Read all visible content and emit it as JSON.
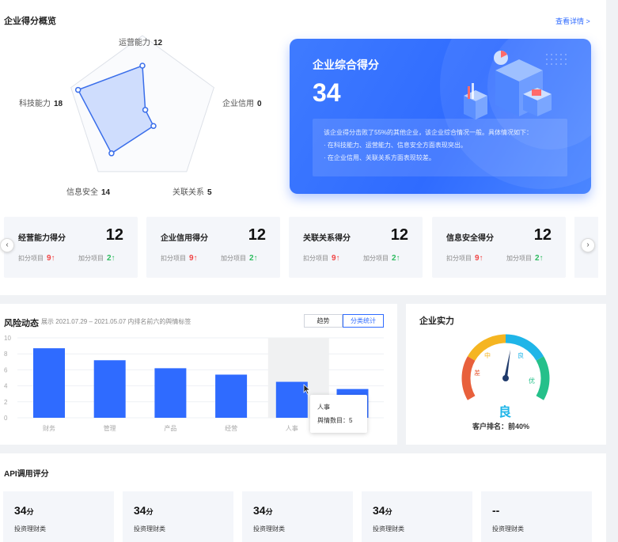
{
  "overview": {
    "title": "企业得分概览",
    "details_link": "查看详情 >",
    "radar": [
      {
        "label": "运营能力",
        "value": "12"
      },
      {
        "label": "企业信用",
        "value": "0"
      },
      {
        "label": "关联关系",
        "value": "5"
      },
      {
        "label": "信息安全",
        "value": "14"
      },
      {
        "label": "科技能力",
        "value": "18"
      }
    ],
    "radar_max": 20
  },
  "score_card": {
    "title": "企业综合得分",
    "score": "34",
    "lines": [
      "该企业得分击败了55%的其他企业，该企业综合情况一般。具体情况如下：",
      "·  在科技能力、运营能力、信息安全方面表现突出。",
      "·  在企业信用、关联关系方面表现较差。"
    ]
  },
  "metrics": [
    {
      "title": "经营能力得分",
      "score": "12",
      "minus_label": "扣分项目",
      "minus_value": "9↑",
      "plus_label": "加分项目",
      "plus_value": "2↑"
    },
    {
      "title": "企业信用得分",
      "score": "12",
      "minus_label": "扣分项目",
      "minus_value": "9↑",
      "plus_label": "加分项目",
      "plus_value": "2↑"
    },
    {
      "title": "关联关系得分",
      "score": "12",
      "minus_label": "扣分项目",
      "minus_value": "9↑",
      "plus_label": "加分项目",
      "plus_value": "2↑"
    },
    {
      "title": "信息安全得分",
      "score": "12",
      "minus_label": "扣分项目",
      "minus_value": "9↑",
      "plus_label": "加分项目",
      "plus_value": "2↑"
    }
  ],
  "nav": {
    "prev": "‹",
    "next": "›"
  },
  "risk": {
    "title": "风险动态",
    "subtitle": "展示 2021.07.29 – 2021.05.07 内排名前六的舆情标签",
    "toggle_trend": "趋势",
    "toggle_category": "分类统计",
    "tooltip_title": "人事",
    "tooltip_text": "舆情数目：5"
  },
  "chart_data": {
    "type": "bar",
    "categories": [
      "财务",
      "管理",
      "产品",
      "经营",
      "人事",
      ""
    ],
    "values": [
      8.7,
      7.2,
      6.2,
      5.4,
      4.5,
      3.6
    ],
    "yticks": [
      "0",
      "2",
      "4",
      "6",
      "8",
      "10"
    ],
    "ylim": [
      0,
      10
    ],
    "highlight_index": 4,
    "bar_color": "#2f6bff"
  },
  "strength": {
    "title": "企业实力",
    "grade": "良",
    "ring_labels": [
      "差",
      "中",
      "良",
      "优"
    ],
    "rank": "客户排名：前40%",
    "colors": [
      "#e8603c",
      "#f5b521",
      "#1fb5e8",
      "#25c08a"
    ]
  },
  "api": {
    "title": "API调用评分",
    "cards": [
      {
        "value": "34",
        "unit": "分",
        "label": "投资理财类"
      },
      {
        "value": "34",
        "unit": "分",
        "label": "投资理财类"
      },
      {
        "value": "34",
        "unit": "分",
        "label": "投资理财类"
      },
      {
        "value": "34",
        "unit": "分",
        "label": "投资理财类"
      },
      {
        "value": "--",
        "unit": "",
        "label": "投资理财类"
      }
    ]
  }
}
